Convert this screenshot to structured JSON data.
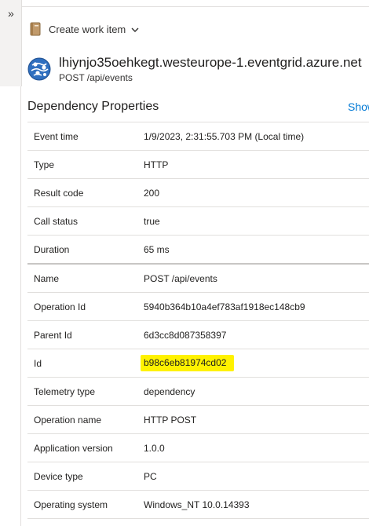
{
  "nav": {
    "expand_glyph": "»"
  },
  "toolbar": {
    "create_work_item_label": "Create work item",
    "create_work_item_icon": "work-item-book-icon",
    "dropdown_icon": "chevron-down-icon"
  },
  "header": {
    "icon": "event-grid-globe-icon",
    "title": "lhiynjo35oehkegt.westeurope-1.eventgrid.azure.net",
    "subtitle": "POST /api/events"
  },
  "section": {
    "title": "Dependency Properties",
    "show_link": "Show"
  },
  "properties": [
    {
      "key": "Event time",
      "value": "1/9/2023, 2:31:55.703 PM (Local time)"
    },
    {
      "key": "Type",
      "value": "HTTP"
    },
    {
      "key": "Result code",
      "value": "200"
    },
    {
      "key": "Call status",
      "value": "true"
    },
    {
      "key": "Duration",
      "value": "65 ms"
    },
    {
      "key": "Name",
      "value": "POST /api/events"
    },
    {
      "key": "Operation Id",
      "value": "5940b364b10a4ef783af1918ec148cb9"
    },
    {
      "key": "Parent Id",
      "value": "6d3cc8d087358397"
    },
    {
      "key": "Id",
      "value": "b98c6eb81974cd02",
      "highlighted": true
    },
    {
      "key": "Telemetry type",
      "value": "dependency"
    },
    {
      "key": "Operation name",
      "value": "HTTP POST"
    },
    {
      "key": "Application version",
      "value": "1.0.0"
    },
    {
      "key": "Device type",
      "value": "PC"
    },
    {
      "key": "Operating system",
      "value": "Windows_NT 10.0.14393"
    }
  ],
  "colors": {
    "link": "#0078d4",
    "highlight": "#fff200",
    "logo_blue": "#2f6fbf"
  }
}
